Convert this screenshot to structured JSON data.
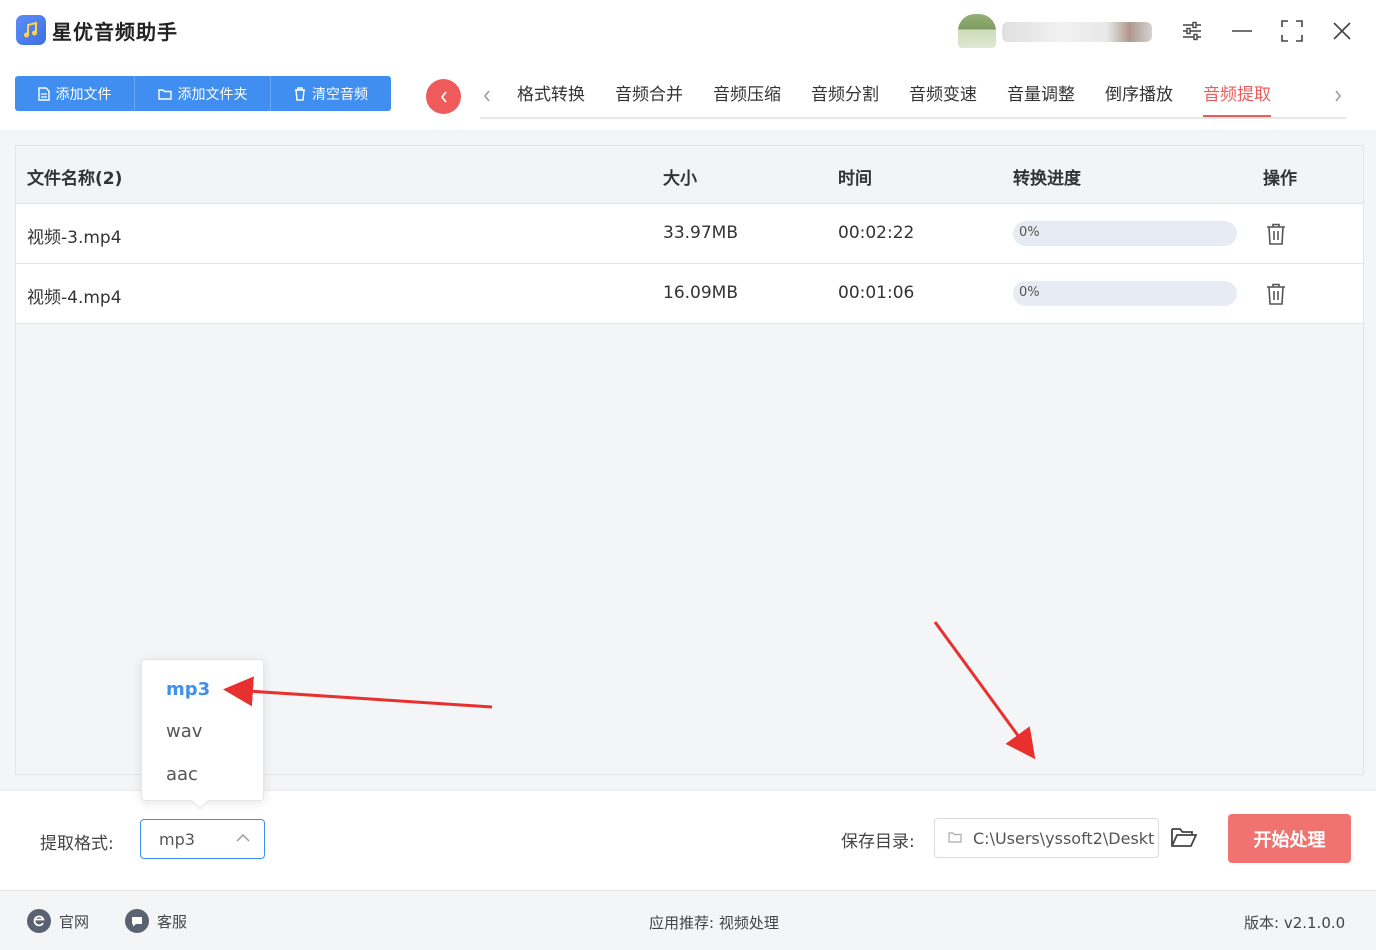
{
  "app": {
    "title": "星优音频助手"
  },
  "toolbar": {
    "add_file": "添加文件",
    "add_folder": "添加文件夹",
    "clear_audio": "清空音频"
  },
  "tabs": [
    {
      "label": "格式转换",
      "active": false
    },
    {
      "label": "音频合并",
      "active": false
    },
    {
      "label": "音频压缩",
      "active": false
    },
    {
      "label": "音频分割",
      "active": false
    },
    {
      "label": "音频变速",
      "active": false
    },
    {
      "label": "音量调整",
      "active": false
    },
    {
      "label": "倒序播放",
      "active": false
    },
    {
      "label": "音频提取",
      "active": true
    }
  ],
  "table": {
    "headers": {
      "name": "文件名称(2)",
      "size": "大小",
      "time": "时间",
      "progress": "转换进度",
      "action": "操作"
    },
    "rows": [
      {
        "name": "视频-3.mp4",
        "size": "33.97MB",
        "time": "00:02:22",
        "progress_text": "0%",
        "progress": 0
      },
      {
        "name": "视频-4.mp4",
        "size": "16.09MB",
        "time": "00:01:06",
        "progress_text": "0%",
        "progress": 0
      }
    ]
  },
  "format_dropdown": {
    "options": [
      "mp3",
      "wav",
      "aac"
    ],
    "selected": "mp3"
  },
  "settings": {
    "format_label": "提取格式:",
    "format_value": "mp3",
    "save_label": "保存目录:",
    "save_path": "C:\\Users\\yssoft2\\Deskt",
    "start_button": "开始处理"
  },
  "statusbar": {
    "website": "官网",
    "support": "客服",
    "recommend": "应用推荐:  视频处理",
    "version": "版本:  v2.1.0.0"
  },
  "colors": {
    "primary": "#3f8ef0",
    "accent_red": "#ee5b5b",
    "start_button": "#f07372"
  }
}
